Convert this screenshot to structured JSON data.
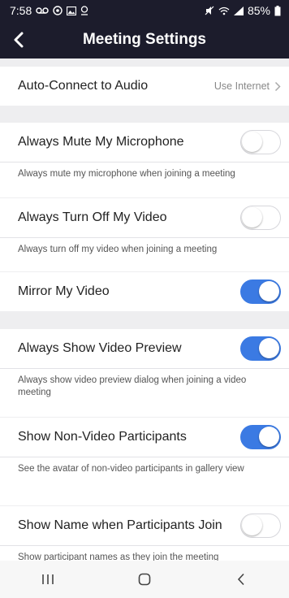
{
  "status_bar": {
    "time": "7:58",
    "battery": "85%"
  },
  "header": {
    "title": "Meeting Settings"
  },
  "settings": {
    "auto_connect": {
      "label": "Auto-Connect to Audio",
      "value": "Use Internet"
    },
    "mute_mic": {
      "label": "Always Mute My Microphone",
      "enabled": false,
      "description": "Always mute my microphone when joining a meeting"
    },
    "video_off": {
      "label": "Always Turn Off My Video",
      "enabled": false,
      "description": "Always turn off my video when joining a meeting"
    },
    "mirror": {
      "label": "Mirror My Video",
      "enabled": true
    },
    "preview": {
      "label": "Always Show Video Preview",
      "enabled": true,
      "description": "Always show video preview dialog when joining a video meeting"
    },
    "non_video": {
      "label": "Show Non-Video Participants",
      "enabled": true,
      "description": "See the avatar of non-video participants in gallery view"
    },
    "show_name": {
      "label": "Show Name when Participants Join",
      "enabled": false,
      "description": "Show participant names as they join the meeting"
    }
  },
  "colors": {
    "header_bg": "#1c1c2c",
    "toggle_on": "#3b7ae3",
    "background": "#eeeef0"
  },
  "nav": {
    "icons": [
      "recent-apps-icon",
      "home-icon",
      "back-icon"
    ]
  }
}
